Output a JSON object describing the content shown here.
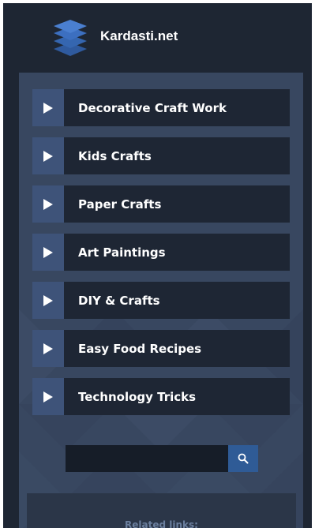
{
  "site": {
    "title": "Kardasti.net",
    "logo_icon": "stacked-layers-icon"
  },
  "menu": {
    "items": [
      {
        "label": "Decorative Craft Work",
        "icon": "triangle-right-icon"
      },
      {
        "label": "Kids Crafts",
        "icon": "triangle-right-icon"
      },
      {
        "label": "Paper Crafts",
        "icon": "triangle-right-icon"
      },
      {
        "label": "Art Paintings",
        "icon": "triangle-right-icon"
      },
      {
        "label": "DIY & Crafts",
        "icon": "triangle-right-icon"
      },
      {
        "label": "Easy Food Recipes",
        "icon": "triangle-right-icon"
      },
      {
        "label": "Technology Tricks",
        "icon": "triangle-right-icon"
      }
    ]
  },
  "search": {
    "value": "",
    "icon": "search-icon"
  },
  "related": {
    "label": "Related links:"
  },
  "colors": {
    "header_bg": "#1e2633",
    "panel_bg": "#384760",
    "arrow_bg": "#3e5379",
    "item_bg": "#1e2634",
    "search_button": "#2f5b96",
    "logo_blue": "#3c6fc0"
  }
}
